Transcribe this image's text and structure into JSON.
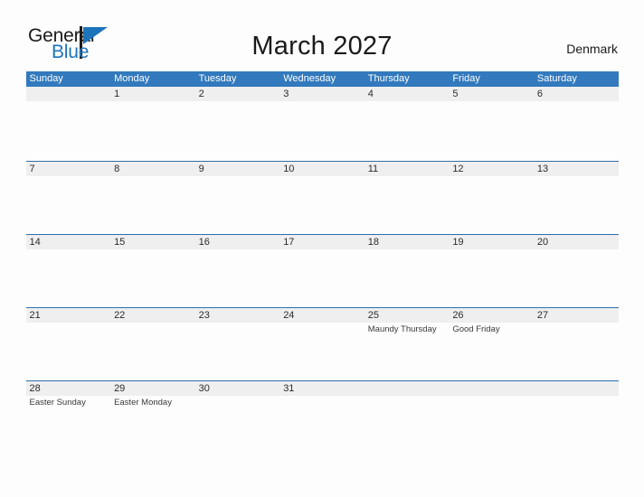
{
  "brand": {
    "name_part1": "General",
    "name_part2": "Blue",
    "mark_icon": "triangle-flag-icon",
    "accent_color": "#1c74bb"
  },
  "header": {
    "title": "March 2027",
    "locale": "Denmark"
  },
  "theme": {
    "header_blue": "#3279bd",
    "row_divider_blue": "#2f6ea8",
    "daynum_band": "#efefef",
    "page_background": "#fdfdfd",
    "text_color": "#1a1a1a"
  },
  "calendar": {
    "month": "March",
    "year": "2027",
    "weekday_headers": [
      "Sunday",
      "Monday",
      "Tuesday",
      "Wednesday",
      "Thursday",
      "Friday",
      "Saturday"
    ],
    "weeks": [
      {
        "days": [
          {
            "num": "",
            "event": ""
          },
          {
            "num": "1",
            "event": ""
          },
          {
            "num": "2",
            "event": ""
          },
          {
            "num": "3",
            "event": ""
          },
          {
            "num": "4",
            "event": ""
          },
          {
            "num": "5",
            "event": ""
          },
          {
            "num": "6",
            "event": ""
          }
        ]
      },
      {
        "days": [
          {
            "num": "7",
            "event": ""
          },
          {
            "num": "8",
            "event": ""
          },
          {
            "num": "9",
            "event": ""
          },
          {
            "num": "10",
            "event": ""
          },
          {
            "num": "11",
            "event": ""
          },
          {
            "num": "12",
            "event": ""
          },
          {
            "num": "13",
            "event": ""
          }
        ]
      },
      {
        "days": [
          {
            "num": "14",
            "event": ""
          },
          {
            "num": "15",
            "event": ""
          },
          {
            "num": "16",
            "event": ""
          },
          {
            "num": "17",
            "event": ""
          },
          {
            "num": "18",
            "event": ""
          },
          {
            "num": "19",
            "event": ""
          },
          {
            "num": "20",
            "event": ""
          }
        ]
      },
      {
        "days": [
          {
            "num": "21",
            "event": ""
          },
          {
            "num": "22",
            "event": ""
          },
          {
            "num": "23",
            "event": ""
          },
          {
            "num": "24",
            "event": ""
          },
          {
            "num": "25",
            "event": "Maundy Thursday"
          },
          {
            "num": "26",
            "event": "Good Friday"
          },
          {
            "num": "27",
            "event": ""
          }
        ]
      },
      {
        "days": [
          {
            "num": "28",
            "event": "Easter Sunday"
          },
          {
            "num": "29",
            "event": "Easter Monday"
          },
          {
            "num": "30",
            "event": ""
          },
          {
            "num": "31",
            "event": ""
          },
          {
            "num": "",
            "event": ""
          },
          {
            "num": "",
            "event": ""
          },
          {
            "num": "",
            "event": ""
          }
        ]
      }
    ]
  }
}
